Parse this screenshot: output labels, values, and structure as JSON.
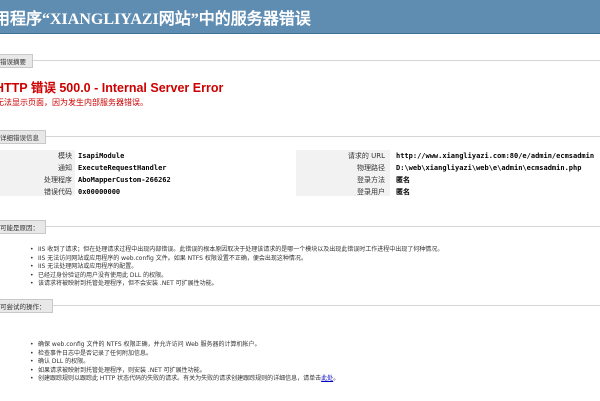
{
  "page": {
    "title": "用程序“XIANGLIYAZI网站”中的服务器错误"
  },
  "summary": {
    "legend": "错误摘要",
    "error_title": "HTTP 错误 500.0 - Internal Server Error",
    "error_desc": "无法显示页面，因为发生内部服务器错误。"
  },
  "detail": {
    "legend": "详细错误信息",
    "left": [
      {
        "label": "模块",
        "value": "IsapiModule"
      },
      {
        "label": "通知",
        "value": "ExecuteRequestHandler"
      },
      {
        "label": "处理程序",
        "value": "AboMapperCustom-266262"
      },
      {
        "label": "错误代码",
        "value": "0x00000000"
      }
    ],
    "right": [
      {
        "label": "请求的 URL",
        "value": "http://www.xiangliyazi.com:80/e/admin/ecmsadmin"
      },
      {
        "label": "物理路径",
        "value": "D:\\web\\xiangliyazi\\web\\e\\admin\\ecmsadmin.php"
      },
      {
        "label": "登录方法",
        "value": "匿名"
      },
      {
        "label": "登录用户",
        "value": "匿名"
      }
    ]
  },
  "causes": {
    "legend": "可能是原因：",
    "items": [
      "IIS 收到了请求；但在处理请求过程中出现内部错误。此错误的根本原因取决于处理该请求的是哪一个模块以及出现此错误时工作进程中出现了何种情况。",
      "IIS 无法访问网站或应用程序的 web.config 文件。如果 NTFS 权限设置不正确，便会出现这种情况。",
      "IIS 无法处理网站或应用程序的配置。",
      "已经过身份验证的用户没有使用此 DLL 的权限。",
      "该请求将被映射到托管处理程序，但不会安装 .NET 可扩展性功能。"
    ]
  },
  "actions": {
    "legend": "可尝试的操作：",
    "items": [
      "确保 web.config 文件的 NTFS 权限正确，并允许访问 Web 服务器的计算机帐户。",
      "检查事件日志中是否记录了任何附加信息。",
      "确认 DLL 的权限。",
      "如果请求被映射到托管处理程序，则安装 .NET 可扩展性功能。",
      "创建跟踪规则以跟踪此 HTTP 状态代码的失败的请求。有关为失败的请求创建跟踪规则的详细信息，请单击"
    ],
    "link_label": "此处",
    "trailing": "。"
  },
  "colors": {
    "titlebar": "#5f8db2",
    "error_red": "#cc0000",
    "link": "#0000cc"
  }
}
